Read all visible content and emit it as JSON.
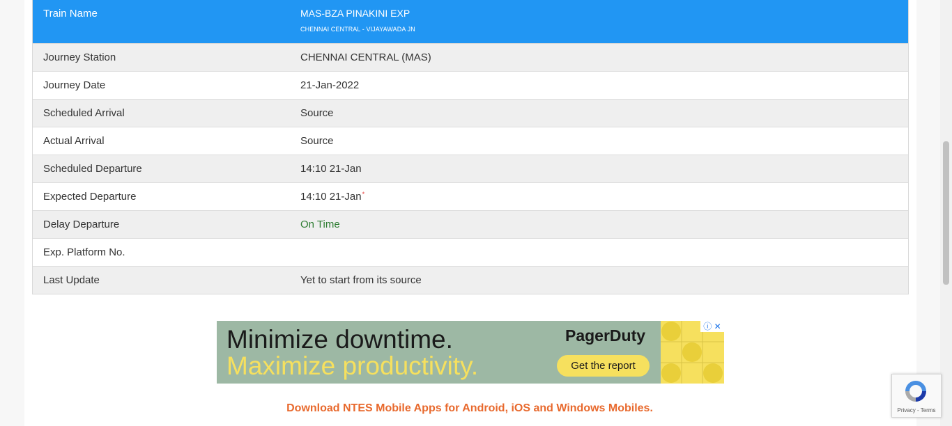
{
  "train": {
    "label": "Train Name",
    "name": "MAS-BZA PINAKINI EXP",
    "route": "CHENNAI CENTRAL - VIJAYAWADA JN"
  },
  "rows": [
    {
      "label": "Journey Station",
      "value": "CHENNAI CENTRAL (MAS)"
    },
    {
      "label": "Journey Date",
      "value": "21-Jan-2022"
    },
    {
      "label": "Scheduled Arrival",
      "value": "Source"
    },
    {
      "label": "Actual Arrival",
      "value": "Source"
    },
    {
      "label": "Scheduled Departure",
      "value": "14:10 21-Jan"
    },
    {
      "label": "Expected Departure",
      "value": "14:10 21-Jan",
      "marker": "*"
    },
    {
      "label": "Delay Departure",
      "value": "On Time"
    },
    {
      "label": "Exp. Platform No.",
      "value": ""
    },
    {
      "label": "Last Update",
      "value": "Yet to start from its source"
    }
  ],
  "ad": {
    "line1": "Minimize downtime.",
    "line2": "Maximize productivity.",
    "brand": "PagerDuty",
    "cta": "Get the report",
    "info_icon": "adchoices-icon",
    "close_icon": "close-icon",
    "colors": {
      "background": "#9db8a4",
      "accent": "#f6e05e"
    }
  },
  "download_text": "Download NTES Mobile Apps for Android, iOS and Windows Mobiles.",
  "recaptcha": {
    "links": "Privacy - Terms"
  },
  "colors": {
    "header": "#2196f3",
    "on_time": "#2e7d32",
    "download": "#e8692d"
  }
}
